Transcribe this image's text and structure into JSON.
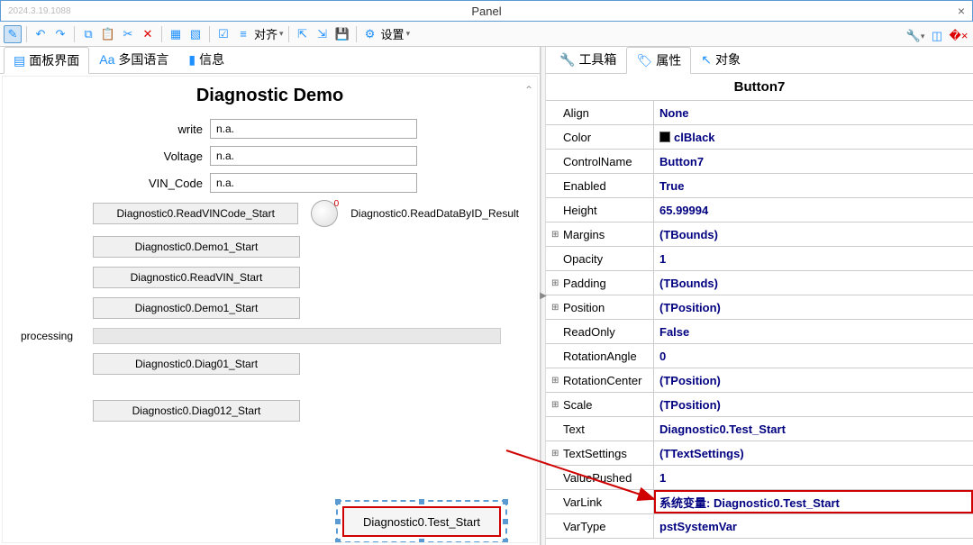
{
  "titlebar": {
    "version": "2024.3.19.1088",
    "title": "Panel",
    "close": "×"
  },
  "toolbar": {
    "align_label": "对齐",
    "settings_label": "设置"
  },
  "left_tabs": {
    "t1": "面板界面",
    "t2": "多国语言",
    "t3": "信息"
  },
  "right_tabs": {
    "t1": "工具箱",
    "t2": "属性",
    "t3": "对象"
  },
  "designer": {
    "title": "Diagnostic Demo",
    "fields": {
      "write": {
        "label": "write",
        "value": "n.a."
      },
      "voltage": {
        "label": "Voltage",
        "value": "n.a."
      },
      "vin": {
        "label": "VIN_Code",
        "value": "n.a."
      }
    },
    "buttons": {
      "b1": "Diagnostic0.ReadVINCode_Start",
      "b2": "Diagnostic0.Demo1_Start",
      "b3": "Diagnostic0.ReadVIN_Start",
      "b4": "Diagnostic0.Demo1_Start",
      "b5": "Diagnostic0.Diag01_Start",
      "b6": "Diagnostic0.Diag012_Start",
      "sel": "Diagnostic0.Test_Start"
    },
    "gauge_value": "0",
    "result_label": "Diagnostic0.ReadDataByID_Result",
    "processing_label": "processing"
  },
  "object_name": "Button7",
  "props": [
    {
      "key": "Align",
      "val": "None",
      "exp": ""
    },
    {
      "key": "Color",
      "val": "clBlack",
      "exp": "",
      "swatch": true
    },
    {
      "key": "ControlName",
      "val": "Button7",
      "exp": ""
    },
    {
      "key": "Enabled",
      "val": "True",
      "exp": ""
    },
    {
      "key": "Height",
      "val": "65.99994",
      "exp": ""
    },
    {
      "key": "Margins",
      "val": "(TBounds)",
      "exp": "⊞"
    },
    {
      "key": "Opacity",
      "val": "1",
      "exp": ""
    },
    {
      "key": "Padding",
      "val": "(TBounds)",
      "exp": "⊞"
    },
    {
      "key": "Position",
      "val": "(TPosition)",
      "exp": "⊞"
    },
    {
      "key": "ReadOnly",
      "val": "False",
      "exp": ""
    },
    {
      "key": "RotationAngle",
      "val": "0",
      "exp": ""
    },
    {
      "key": "RotationCenter",
      "val": "(TPosition)",
      "exp": "⊞"
    },
    {
      "key": "Scale",
      "val": "(TPosition)",
      "exp": "⊞"
    },
    {
      "key": "Text",
      "val": "Diagnostic0.Test_Start",
      "exp": ""
    },
    {
      "key": "TextSettings",
      "val": "(TTextSettings)",
      "exp": "⊞"
    },
    {
      "key": "ValuePushed",
      "val": "1",
      "exp": ""
    },
    {
      "key": "VarLink",
      "val": "系统变量: Diagnostic0.Test_Start",
      "exp": "",
      "hl": true
    },
    {
      "key": "VarType",
      "val": "pstSystemVar",
      "exp": ""
    }
  ]
}
